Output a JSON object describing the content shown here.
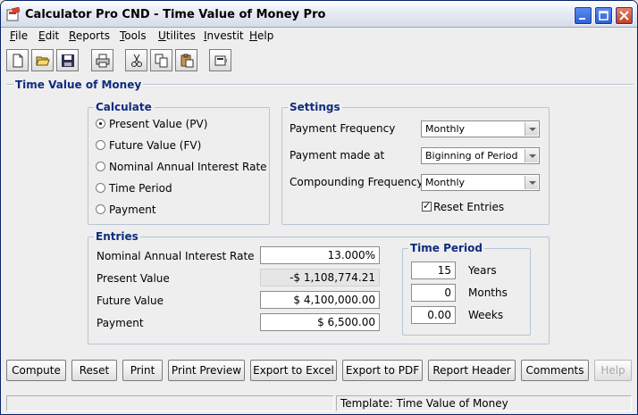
{
  "window": {
    "title": "Calculator Pro CND - Time Value of Money Pro"
  },
  "menu": [
    {
      "label": "File",
      "mnemonic": "F",
      "rest": "ile"
    },
    {
      "label": "Edit",
      "mnemonic": "E",
      "rest": "dit"
    },
    {
      "label": "Reports",
      "mnemonic": "R",
      "rest": "eports"
    },
    {
      "label": "Tools",
      "mnemonic": "T",
      "rest": "ools"
    },
    {
      "label": "Utilites",
      "mnemonic": "U",
      "rest": "tilites"
    },
    {
      "label": "Investit",
      "mnemonic": "I",
      "rest": "nvestit"
    },
    {
      "label": "Help",
      "mnemonic": "H",
      "rest": "elp"
    }
  ],
  "toolbar": {
    "icons": [
      "new-document-icon",
      "open-folder-icon",
      "save-disk-icon",
      "print-icon",
      "cut-scissors-icon",
      "copy-icon",
      "paste-icon",
      "calculator-icon"
    ]
  },
  "panel": {
    "title": "Time Value of Money"
  },
  "calculate": {
    "title": "Calculate",
    "options": [
      "Present Value (PV)",
      "Future Value (FV)",
      "Nominal Annual Interest Rate",
      "Time Period",
      "Payment"
    ],
    "selected": "Present Value (PV)"
  },
  "settings": {
    "title": "Settings",
    "payment_frequency_label": "Payment Frequency",
    "payment_frequency_value": "Monthly",
    "payment_made_at_label": "Payment made at",
    "payment_made_at_value": "Biginning of Period",
    "compounding_frequency_label": "Compounding Frequency",
    "compounding_frequency_value": "Monthly",
    "reset_entries_label": "Reset Entries",
    "reset_entries_checked": true
  },
  "entries": {
    "title": "Entries",
    "interest_rate_label": "Nominal Annual Interest Rate",
    "interest_rate_value": "13.000%",
    "present_value_label": "Present Value",
    "present_value_value": "-$ 1,108,774.21",
    "future_value_label": "Future Value",
    "future_value_value": "$ 4,100,000.00",
    "payment_label": "Payment",
    "payment_value": "$ 6,500.00"
  },
  "time_period": {
    "title": "Time Period",
    "years_value": "15",
    "years_label": "Years",
    "months_value": "0",
    "months_label": "Months",
    "weeks_value": "0.00",
    "weeks_label": "Weeks"
  },
  "buttons": {
    "compute": "Compute",
    "reset": "Reset",
    "print": "Print",
    "print_preview": "Print Preview",
    "export_excel": "Export to Excel",
    "export_pdf": "Export to PDF",
    "report_header": "Report Header",
    "comments": "Comments",
    "help": "Help"
  },
  "status": {
    "left": "",
    "template": "Template: Time Value of Money"
  },
  "colors": {
    "group_title": "#0e2c7e",
    "title_bar_button": "#2a5fd8",
    "close_button": "#c0401e"
  }
}
